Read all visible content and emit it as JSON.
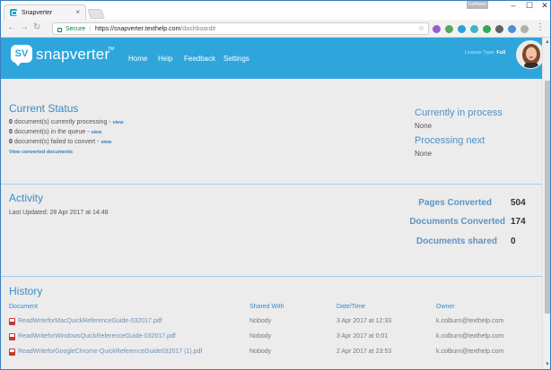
{
  "browser": {
    "tab_title": "Snapverter",
    "tab_close": "×",
    "profile_label": "Kathleen",
    "url_secure": "Secure",
    "url_host": "https://snapverter.texthelp.com",
    "url_path": "/dashboard#",
    "window_controls": [
      "–",
      "☐",
      "✕"
    ]
  },
  "header": {
    "logo_badge": "SV",
    "logo_text": "snapverter",
    "logo_tm": "TM",
    "nav": [
      "Home",
      "Help",
      "Feedback",
      "Settings"
    ],
    "license_label": "License Type:",
    "license_value": "Full",
    "brand_color": "#2ea6dc"
  },
  "current_status": {
    "title": "Current Status",
    "lines": [
      {
        "count": "0",
        "text": " document(s) currently processing - ",
        "link": "view"
      },
      {
        "count": "0",
        "text": " document(s) in the queue - ",
        "link": "view"
      },
      {
        "count": "0",
        "text": " document(s) failed to convert - ",
        "link": "view"
      }
    ],
    "converted_link": "View converted documents",
    "in_process_title": "Currently in process",
    "in_process_value": "None",
    "next_title": "Processing next",
    "next_value": "None"
  },
  "activity": {
    "title": "Activity",
    "last_updated": "Last Updated: 28 Apr 2017 at 14:48",
    "stats": [
      {
        "label": "Pages Converted",
        "value": "504"
      },
      {
        "label": "Documents Converted",
        "value": "174"
      },
      {
        "label": "Documents shared",
        "value": "0"
      }
    ]
  },
  "history": {
    "title": "History",
    "columns": [
      "Document",
      "Shared With",
      "Date/Time",
      "Owner"
    ],
    "rows": [
      [
        "ReadWriteforMacQuickReferenceGuide-032017.pdf",
        "Nobody",
        "3 Apr 2017 at 12:33",
        "k.colburn@texthelp.com"
      ],
      [
        "ReadWriteforWindowsQuickReferenceGuide-032017.pdf",
        "Nobody",
        "3 Apr 2017 at 0:01",
        "k.colburn@texthelp.com"
      ],
      [
        "ReadWriteforGoogleChrome-QuickReferenceGuide032017 (1).pdf",
        "Nobody",
        "2 Apr 2017 at 23:53",
        "k.colburn@texthelp.com"
      ]
    ]
  }
}
